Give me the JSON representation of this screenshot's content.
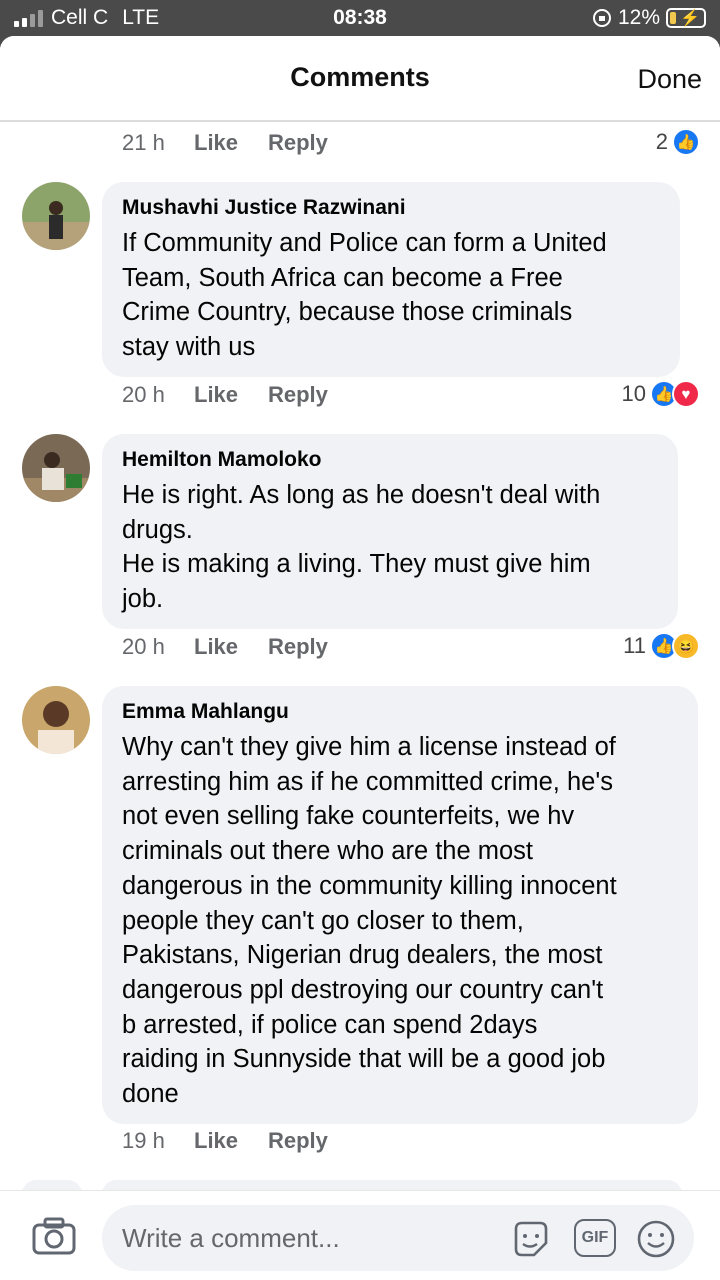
{
  "status": {
    "carrier": "Cell C",
    "network": "LTE",
    "time": "08:38",
    "battery": "12%"
  },
  "header": {
    "title": "Comments",
    "done": "Done"
  },
  "top_meta": {
    "time": "21 h",
    "like": "Like",
    "reply": "Reply",
    "reactions": "2"
  },
  "comments": [
    {
      "name": "Mushavhi Justice Razwinani",
      "text": "If Community and Police can form a United\nTeam, South Africa can become a Free\nCrime Country, because those criminals\nstay with us",
      "time": "20 h",
      "like": "Like",
      "reply": "Reply",
      "reactions": "10"
    },
    {
      "name": "Hemilton Mamoloko",
      "text": "He is right. As long as he doesn't deal with\ndrugs.\nHe is making a living. They must give him\njob.",
      "time": "20 h",
      "like": "Like",
      "reply": "Reply",
      "reactions": "11"
    },
    {
      "name": "Emma Mahlangu",
      "text": "Why can't they give him a license instead of\narresting him as if he committed crime, he's\nnot even selling fake counterfeits, we hv\ncriminals out there who are the most\ndangerous in the community killing innocent\npeople they can't go closer to them,\nPakistans, Nigerian drug dealers, the most\ndangerous ppl destroying our country can't\nb arrested, if police can spend 2days\nraiding in Sunnyside that will be a good job\ndone",
      "time": "19 h",
      "like": "Like",
      "reply": "Reply"
    }
  ],
  "composer": {
    "placeholder": "Write a comment...",
    "gif": "GIF"
  },
  "icons": [
    "camera-icon",
    "sticker-icon",
    "gif-icon",
    "emoji-icon",
    "like-reaction-icon",
    "love-reaction-icon",
    "haha-reaction-icon"
  ],
  "colors": {
    "accent": "#1877f2",
    "bubble": "#f0f2f5",
    "love": "#f02849",
    "haha": "#f7b928"
  }
}
